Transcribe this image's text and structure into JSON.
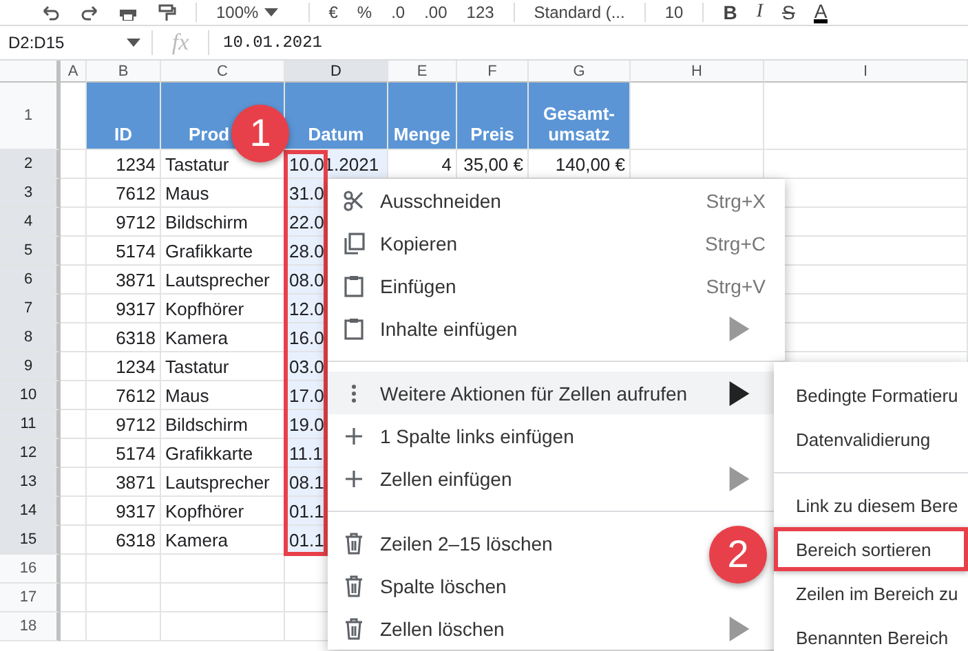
{
  "toolbar": {
    "zoom": "100%",
    "format_buttons": [
      "€",
      "%",
      ".0",
      ".00",
      "123"
    ],
    "number_format": "Standard (...",
    "font_size": "10",
    "style_buttons": [
      "B",
      "I",
      "S",
      "A"
    ]
  },
  "formula_bar": {
    "name_box": "D2:D15",
    "fx": "fx",
    "value": "10.01.2021"
  },
  "sheet": {
    "columns": [
      {
        "label": "A",
        "selected": false
      },
      {
        "label": "B",
        "selected": false
      },
      {
        "label": "C",
        "selected": false
      },
      {
        "label": "D",
        "selected": true
      },
      {
        "label": "E",
        "selected": false
      },
      {
        "label": "F",
        "selected": false
      },
      {
        "label": "G",
        "selected": false
      },
      {
        "label": "H",
        "selected": false
      },
      {
        "label": "I",
        "selected": false
      }
    ],
    "header_row": {
      "number": "1",
      "cells": [
        "ID",
        "Prod",
        "Datum",
        "Menge",
        "Preis",
        "Gesamt-umsatz"
      ]
    },
    "rows": [
      {
        "number": "2",
        "selected": true,
        "id": "1234",
        "product": "Tastatur",
        "date": "10.01.2021",
        "quantity": "4",
        "price": "35,00 €",
        "total": "140,00 €"
      },
      {
        "number": "3",
        "selected": true,
        "id": "7612",
        "product": "Maus",
        "date": "31.0"
      },
      {
        "number": "4",
        "selected": true,
        "id": "9712",
        "product": "Bildschirm",
        "date": "22.0"
      },
      {
        "number": "5",
        "selected": true,
        "id": "5174",
        "product": "Grafikkarte",
        "date": "28.0"
      },
      {
        "number": "6",
        "selected": true,
        "id": "3871",
        "product": "Lautsprecher",
        "date": "08.0"
      },
      {
        "number": "7",
        "selected": true,
        "id": "9317",
        "product": "Kopfhörer",
        "date": "12.0"
      },
      {
        "number": "8",
        "selected": true,
        "id": "6318",
        "product": "Kamera",
        "date": "16.0"
      },
      {
        "number": "9",
        "selected": true,
        "id": "1234",
        "product": "Tastatur",
        "date": "03.0"
      },
      {
        "number": "10",
        "selected": true,
        "id": "7612",
        "product": "Maus",
        "date": "17.0"
      },
      {
        "number": "11",
        "selected": true,
        "id": "9712",
        "product": "Bildschirm",
        "date": "19.0"
      },
      {
        "number": "12",
        "selected": true,
        "id": "5174",
        "product": "Grafikkarte",
        "date": "11.1"
      },
      {
        "number": "13",
        "selected": true,
        "id": "3871",
        "product": "Lautsprecher",
        "date": "08.1"
      },
      {
        "number": "14",
        "selected": true,
        "id": "9317",
        "product": "Kopfhörer",
        "date": "01.1"
      },
      {
        "number": "15",
        "selected": true,
        "id": "6318",
        "product": "Kamera",
        "date": "01.1"
      },
      {
        "number": "16",
        "selected": false
      },
      {
        "number": "17",
        "selected": false
      },
      {
        "number": "18",
        "selected": false
      }
    ]
  },
  "context_menu": {
    "sections": [
      [
        {
          "label": "Ausschneiden",
          "shortcut": "Strg+X",
          "submenu": false,
          "selected": false
        },
        {
          "label": "Kopieren",
          "shortcut": "Strg+C",
          "submenu": false,
          "selected": false
        },
        {
          "label": "Einfügen",
          "shortcut": "Strg+V",
          "submenu": false,
          "selected": false
        },
        {
          "label": "Inhalte einfügen",
          "submenu": true,
          "selected": false
        }
      ],
      [
        {
          "label": "Weitere Aktionen für Zellen aufrufen",
          "submenu": true,
          "selected": true
        },
        {
          "label": "1 Spalte links einfügen",
          "submenu": false,
          "selected": false
        },
        {
          "label": "Zellen einfügen",
          "submenu": true,
          "selected": false
        }
      ],
      [
        {
          "label": "Zeilen 2–15 löschen",
          "submenu": false,
          "selected": false
        },
        {
          "label": "Spalte löschen",
          "submenu": false,
          "selected": false
        },
        {
          "label": "Zellen löschen",
          "submenu": true,
          "selected": false
        }
      ]
    ]
  },
  "submenu": {
    "sections": [
      [
        {
          "label": "Bedingte Formatieru",
          "annotated": false
        },
        {
          "label": "Datenvalidierung",
          "annotated": false
        }
      ],
      [
        {
          "label": "Link zu diesem Bere",
          "annotated": false
        },
        {
          "label": "Bereich sortieren",
          "annotated": true
        },
        {
          "label": "Zeilen im Bereich zu",
          "annotated": false
        },
        {
          "label": "Benannten Bereich",
          "annotated": false
        }
      ]
    ]
  },
  "callouts": [
    "1",
    "2"
  ]
}
